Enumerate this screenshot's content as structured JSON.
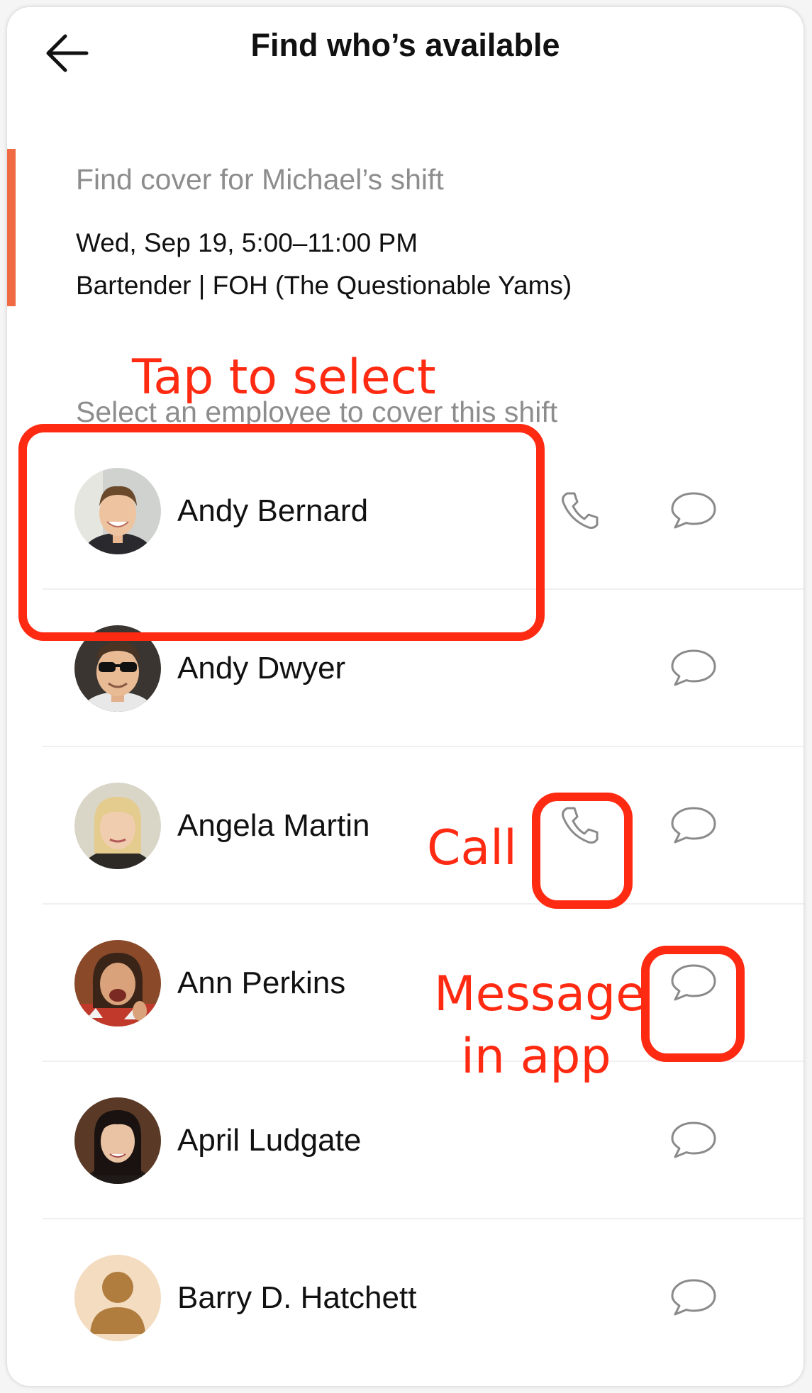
{
  "header": {
    "title": "Find who’s available",
    "back_icon": "arrow-left-icon"
  },
  "shift": {
    "heading": "Find cover for Michael’s shift",
    "time": "Wed, Sep  19, 5:00–11:00 PM",
    "role": "Bartender | FOH (The Questionable Yams)",
    "accent_color": "#f06a43"
  },
  "employee_list": {
    "hint": "Select an employee to cover this shift",
    "employees": [
      {
        "name": "Andy Bernard",
        "has_call": true,
        "has_message": true
      },
      {
        "name": "Andy Dwyer",
        "has_call": false,
        "has_message": true
      },
      {
        "name": "Angela Martin",
        "has_call": true,
        "has_message": true
      },
      {
        "name": "Ann Perkins",
        "has_call": false,
        "has_message": true
      },
      {
        "name": "April Ludgate",
        "has_call": false,
        "has_message": true
      },
      {
        "name": "Barry D. Hatchett",
        "has_call": false,
        "has_message": true
      }
    ]
  },
  "annotations": {
    "tap_to_select": "Tap to select",
    "call": "Call",
    "message_line1": "Message",
    "message_line2": "in app",
    "color": "#ff2a12"
  },
  "colors": {
    "icon_gray": "#8a8a8a",
    "placeholder_avatar_bg": "#f3dcc0",
    "placeholder_avatar_fg": "#b07d3e"
  }
}
